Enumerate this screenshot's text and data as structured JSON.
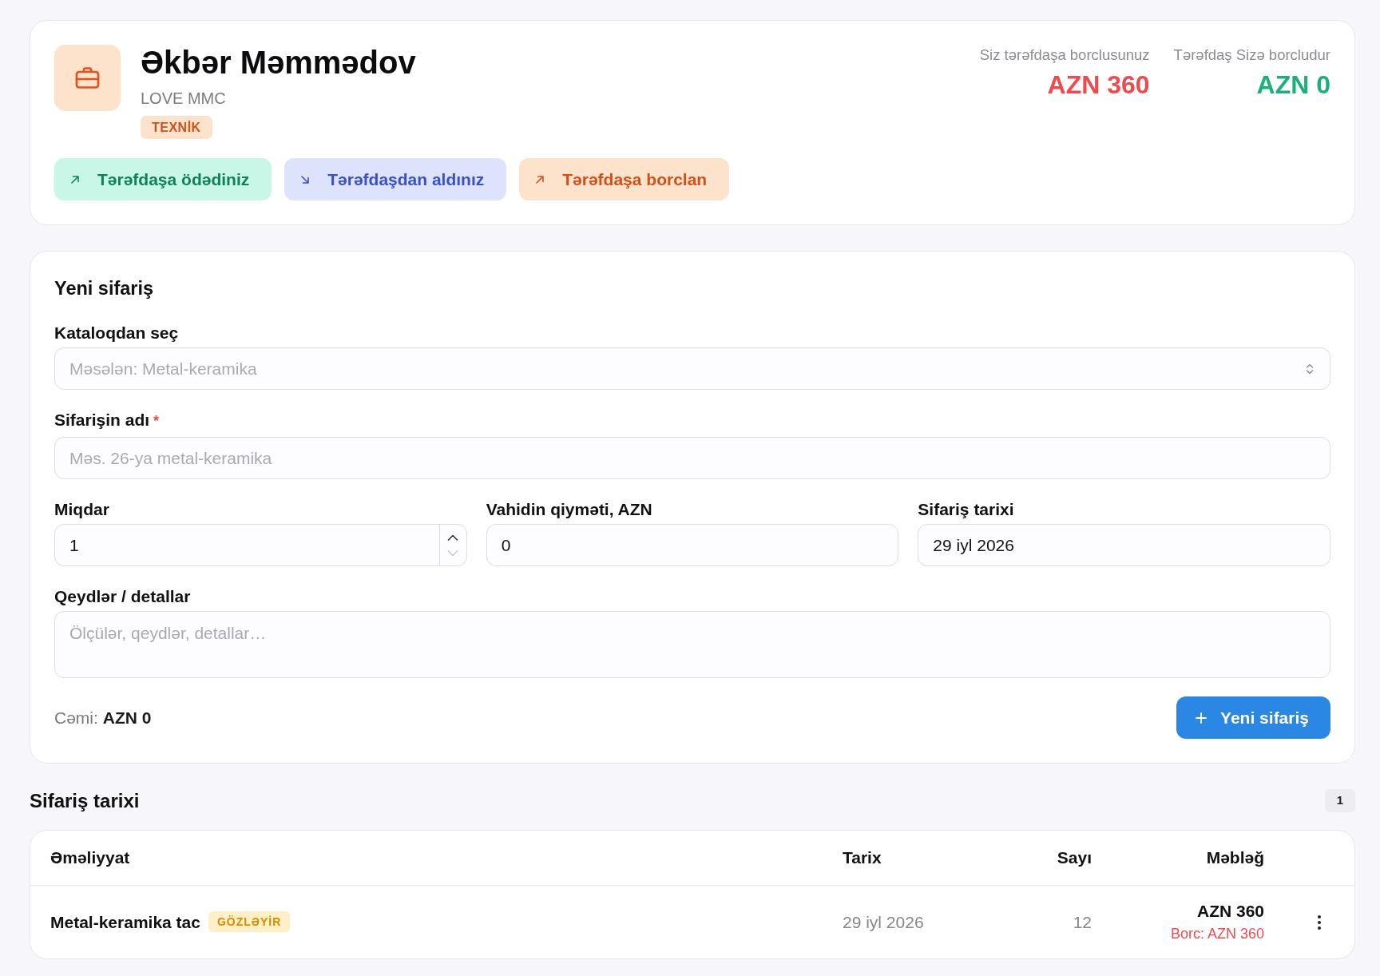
{
  "partner": {
    "name": "Əkbər Məmmədov",
    "company": "LOVE MMC",
    "tag": "TEXNİK",
    "balances": [
      {
        "label": "Siz tərəfdaşa borclusunuz",
        "amount": "AZN 360",
        "kind": "debt"
      },
      {
        "label": "Tərəfdaş Sizə borcludur",
        "amount": "AZN 0",
        "kind": "credit"
      }
    ],
    "actions": [
      {
        "label": "Tərəfdaşa ödədiniz",
        "kind": "paid"
      },
      {
        "label": "Tərəfdaşdan aldınız",
        "kind": "received"
      },
      {
        "label": "Tərəfdaşa borclan",
        "kind": "borrow"
      }
    ]
  },
  "new_order": {
    "title": "Yeni sifariş",
    "field_rows": [
      [
        {
          "kind": "select",
          "label": "Kataloqdan seç",
          "placeholder": "Məsələn: Metal-keramika"
        }
      ],
      [
        {
          "kind": "text",
          "label": "Sifarişin adı",
          "required_mark": "*",
          "placeholder": "Məs. 26-ya metal-keramika"
        }
      ],
      [
        {
          "kind": "number",
          "label": "Miqdar",
          "value": "1",
          "decrease_disabled": true
        },
        {
          "kind": "text",
          "label": "Vahidin qiyməti, AZN",
          "value": "0"
        },
        {
          "kind": "text",
          "label": "Sifariş tarixi",
          "value": "29 iyl 2026"
        }
      ],
      [
        {
          "kind": "textarea",
          "label": "Qeydlər / detallar",
          "placeholder": "Ölçülər, qeydlər, detallar…"
        }
      ]
    ],
    "total_label": "Cəmi:",
    "total": "AZN 0",
    "submit_button": "Yeni sifariş"
  },
  "history": {
    "title": "Sifariş tarixi",
    "count": "1",
    "columns": [
      "Əməliyyat",
      "Tarix",
      "Sayı",
      "Məbləğ"
    ],
    "rows": [
      {
        "operation": "Metal-keramika tac",
        "status": {
          "label": "GÖZLƏYİR",
          "kind": "pending"
        },
        "date": "29 iyl 2026",
        "count": "12",
        "amount": "AZN 360",
        "debt": "Borc: AZN 360"
      }
    ]
  }
}
